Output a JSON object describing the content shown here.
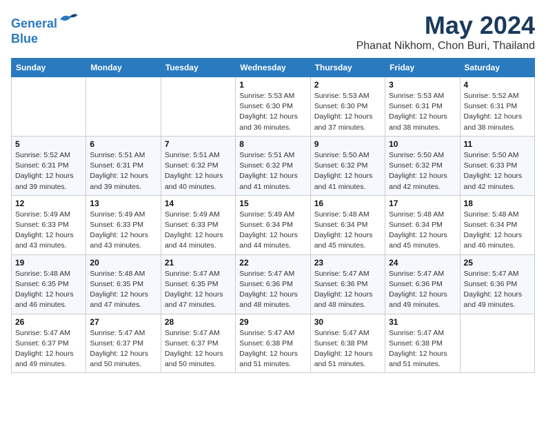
{
  "logo": {
    "line1": "General",
    "line2": "Blue"
  },
  "title": "May 2024",
  "subtitle": "Phanat Nikhom, Chon Buri, Thailand",
  "days_of_week": [
    "Sunday",
    "Monday",
    "Tuesday",
    "Wednesday",
    "Thursday",
    "Friday",
    "Saturday"
  ],
  "weeks": [
    [
      {
        "day": "",
        "info": ""
      },
      {
        "day": "",
        "info": ""
      },
      {
        "day": "",
        "info": ""
      },
      {
        "day": "1",
        "info": "Sunrise: 5:53 AM\nSunset: 6:30 PM\nDaylight: 12 hours\nand 36 minutes."
      },
      {
        "day": "2",
        "info": "Sunrise: 5:53 AM\nSunset: 6:30 PM\nDaylight: 12 hours\nand 37 minutes."
      },
      {
        "day": "3",
        "info": "Sunrise: 5:53 AM\nSunset: 6:31 PM\nDaylight: 12 hours\nand 38 minutes."
      },
      {
        "day": "4",
        "info": "Sunrise: 5:52 AM\nSunset: 6:31 PM\nDaylight: 12 hours\nand 38 minutes."
      }
    ],
    [
      {
        "day": "5",
        "info": "Sunrise: 5:52 AM\nSunset: 6:31 PM\nDaylight: 12 hours\nand 39 minutes."
      },
      {
        "day": "6",
        "info": "Sunrise: 5:51 AM\nSunset: 6:31 PM\nDaylight: 12 hours\nand 39 minutes."
      },
      {
        "day": "7",
        "info": "Sunrise: 5:51 AM\nSunset: 6:32 PM\nDaylight: 12 hours\nand 40 minutes."
      },
      {
        "day": "8",
        "info": "Sunrise: 5:51 AM\nSunset: 6:32 PM\nDaylight: 12 hours\nand 41 minutes."
      },
      {
        "day": "9",
        "info": "Sunrise: 5:50 AM\nSunset: 6:32 PM\nDaylight: 12 hours\nand 41 minutes."
      },
      {
        "day": "10",
        "info": "Sunrise: 5:50 AM\nSunset: 6:32 PM\nDaylight: 12 hours\nand 42 minutes."
      },
      {
        "day": "11",
        "info": "Sunrise: 5:50 AM\nSunset: 6:33 PM\nDaylight: 12 hours\nand 42 minutes."
      }
    ],
    [
      {
        "day": "12",
        "info": "Sunrise: 5:49 AM\nSunset: 6:33 PM\nDaylight: 12 hours\nand 43 minutes."
      },
      {
        "day": "13",
        "info": "Sunrise: 5:49 AM\nSunset: 6:33 PM\nDaylight: 12 hours\nand 43 minutes."
      },
      {
        "day": "14",
        "info": "Sunrise: 5:49 AM\nSunset: 6:33 PM\nDaylight: 12 hours\nand 44 minutes."
      },
      {
        "day": "15",
        "info": "Sunrise: 5:49 AM\nSunset: 6:34 PM\nDaylight: 12 hours\nand 44 minutes."
      },
      {
        "day": "16",
        "info": "Sunrise: 5:48 AM\nSunset: 6:34 PM\nDaylight: 12 hours\nand 45 minutes."
      },
      {
        "day": "17",
        "info": "Sunrise: 5:48 AM\nSunset: 6:34 PM\nDaylight: 12 hours\nand 45 minutes."
      },
      {
        "day": "18",
        "info": "Sunrise: 5:48 AM\nSunset: 6:34 PM\nDaylight: 12 hours\nand 46 minutes."
      }
    ],
    [
      {
        "day": "19",
        "info": "Sunrise: 5:48 AM\nSunset: 6:35 PM\nDaylight: 12 hours\nand 46 minutes."
      },
      {
        "day": "20",
        "info": "Sunrise: 5:48 AM\nSunset: 6:35 PM\nDaylight: 12 hours\nand 47 minutes."
      },
      {
        "day": "21",
        "info": "Sunrise: 5:47 AM\nSunset: 6:35 PM\nDaylight: 12 hours\nand 47 minutes."
      },
      {
        "day": "22",
        "info": "Sunrise: 5:47 AM\nSunset: 6:36 PM\nDaylight: 12 hours\nand 48 minutes."
      },
      {
        "day": "23",
        "info": "Sunrise: 5:47 AM\nSunset: 6:36 PM\nDaylight: 12 hours\nand 48 minutes."
      },
      {
        "day": "24",
        "info": "Sunrise: 5:47 AM\nSunset: 6:36 PM\nDaylight: 12 hours\nand 49 minutes."
      },
      {
        "day": "25",
        "info": "Sunrise: 5:47 AM\nSunset: 6:36 PM\nDaylight: 12 hours\nand 49 minutes."
      }
    ],
    [
      {
        "day": "26",
        "info": "Sunrise: 5:47 AM\nSunset: 6:37 PM\nDaylight: 12 hours\nand 49 minutes."
      },
      {
        "day": "27",
        "info": "Sunrise: 5:47 AM\nSunset: 6:37 PM\nDaylight: 12 hours\nand 50 minutes."
      },
      {
        "day": "28",
        "info": "Sunrise: 5:47 AM\nSunset: 6:37 PM\nDaylight: 12 hours\nand 50 minutes."
      },
      {
        "day": "29",
        "info": "Sunrise: 5:47 AM\nSunset: 6:38 PM\nDaylight: 12 hours\nand 51 minutes."
      },
      {
        "day": "30",
        "info": "Sunrise: 5:47 AM\nSunset: 6:38 PM\nDaylight: 12 hours\nand 51 minutes."
      },
      {
        "day": "31",
        "info": "Sunrise: 5:47 AM\nSunset: 6:38 PM\nDaylight: 12 hours\nand 51 minutes."
      },
      {
        "day": "",
        "info": ""
      }
    ]
  ]
}
